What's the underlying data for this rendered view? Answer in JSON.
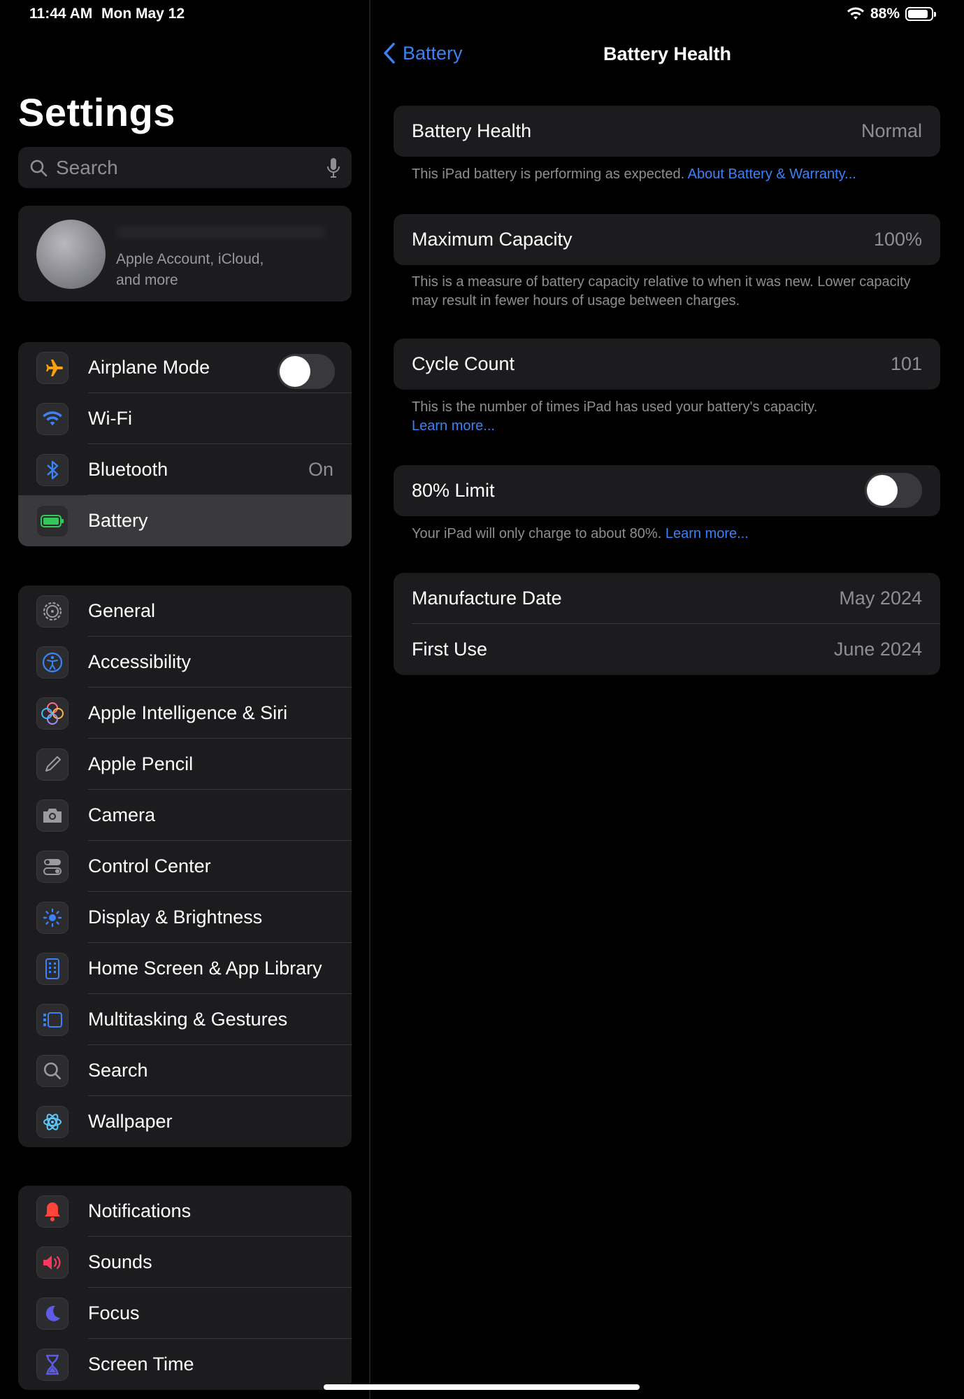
{
  "status_bar": {
    "time": "11:44 AM",
    "date": "Mon May 12",
    "battery_pct": "88%",
    "battery_level": 0.88
  },
  "sidebar": {
    "title": "Settings",
    "search_placeholder": "Search",
    "account": {
      "subtitle_line1": "Apple Account, iCloud,",
      "subtitle_line2": "and more"
    },
    "group1": [
      {
        "label": "Airplane Mode",
        "icon": "airplane-icon",
        "color": "#ff9f0a",
        "toggle": false
      },
      {
        "label": "Wi-Fi",
        "icon": "wifi-icon",
        "color": "#3b82f6"
      },
      {
        "label": "Bluetooth",
        "icon": "bluetooth-icon",
        "color": "#3b82f6",
        "value": "On"
      },
      {
        "label": "Battery",
        "icon": "battery-icon",
        "color": "#34c759",
        "selected": true
      }
    ],
    "group2": [
      {
        "label": "General",
        "icon": "gear-icon"
      },
      {
        "label": "Accessibility",
        "icon": "accessibility-icon"
      },
      {
        "label": "Apple Intelligence & Siri",
        "icon": "siri-icon"
      },
      {
        "label": "Apple Pencil",
        "icon": "pencil-icon"
      },
      {
        "label": "Camera",
        "icon": "camera-icon"
      },
      {
        "label": "Control Center",
        "icon": "control-center-icon"
      },
      {
        "label": "Display & Brightness",
        "icon": "sun-icon"
      },
      {
        "label": "Home Screen & App Library",
        "icon": "home-screen-icon"
      },
      {
        "label": "Multitasking & Gestures",
        "icon": "multitasking-icon"
      },
      {
        "label": "Search",
        "icon": "search-icon"
      },
      {
        "label": "Wallpaper",
        "icon": "wallpaper-icon"
      }
    ],
    "group3": [
      {
        "label": "Notifications",
        "icon": "bell-icon"
      },
      {
        "label": "Sounds",
        "icon": "speaker-icon"
      },
      {
        "label": "Focus",
        "icon": "moon-icon"
      },
      {
        "label": "Screen Time",
        "icon": "hourglass-icon"
      }
    ]
  },
  "detail": {
    "back_label": "Battery",
    "title": "Battery Health",
    "health": {
      "label": "Battery Health",
      "value": "Normal",
      "footer": "This iPad battery is performing as expected. ",
      "footer_link": "About Battery & Warranty..."
    },
    "capacity": {
      "label": "Maximum Capacity",
      "value": "100%",
      "footer": "This is a measure of battery capacity relative to when it was new. Lower capacity may result in fewer hours of usage between charges."
    },
    "cycles": {
      "label": "Cycle Count",
      "value": "101",
      "footer": "This is the number of times iPad has used your battery's capacity.",
      "footer_link": "Learn more..."
    },
    "limit": {
      "label": "80% Limit",
      "toggle": false,
      "footer": "Your iPad will only charge to about 80%. ",
      "footer_link": "Learn more..."
    },
    "dates": [
      {
        "label": "Manufacture Date",
        "value": "May 2024"
      },
      {
        "label": "First Use",
        "value": "June 2024"
      }
    ]
  }
}
